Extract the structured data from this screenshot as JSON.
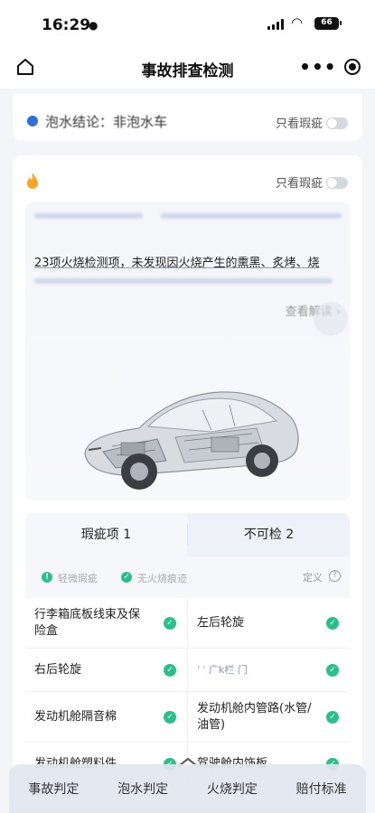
{
  "status": {
    "time": "16:29",
    "battery": "66"
  },
  "nav": {
    "title": "事故排查检测"
  },
  "peek_card": {
    "text": "泡水结论：非泡水车",
    "toggle_label": "只看瑕疵"
  },
  "main_card": {
    "toggle_label": "只看瑕疵",
    "summary": "23项火烧检测项，未发现因火烧产生的熏黑、炙烤、烧",
    "view_detail": "查看解读 ›"
  },
  "tabs": [
    {
      "label": "瑕疵项 1"
    },
    {
      "label": "不可检 2"
    }
  ],
  "legend": {
    "minor": "轻微瑕疵",
    "none": "无火烧痕迹",
    "define": "定义",
    "help": "?"
  },
  "rows": [
    [
      {
        "label": "行李箱底板线束及保险盒"
      },
      {
        "label": "左后轮旋"
      }
    ],
    [
      {
        "label": "右后轮旋"
      },
      {
        "label": "ˈ  ˈ 广k栏 门"
      }
    ],
    [
      {
        "label": "发动机舱隔音棉"
      },
      {
        "label": "发动机舱内管路(水管/油管)"
      }
    ],
    [
      {
        "label": "发动机舱塑料件"
      },
      {
        "label": "驾驶舱内饰板"
      }
    ]
  ],
  "bottom_nav": [
    {
      "label": "事故判定"
    },
    {
      "label": "泡水判定"
    },
    {
      "label": "火烧判定"
    },
    {
      "label": "赔付标准"
    }
  ],
  "colors": {
    "accent_green": "#2bbf8a",
    "fire_orange": "#f5a623"
  }
}
